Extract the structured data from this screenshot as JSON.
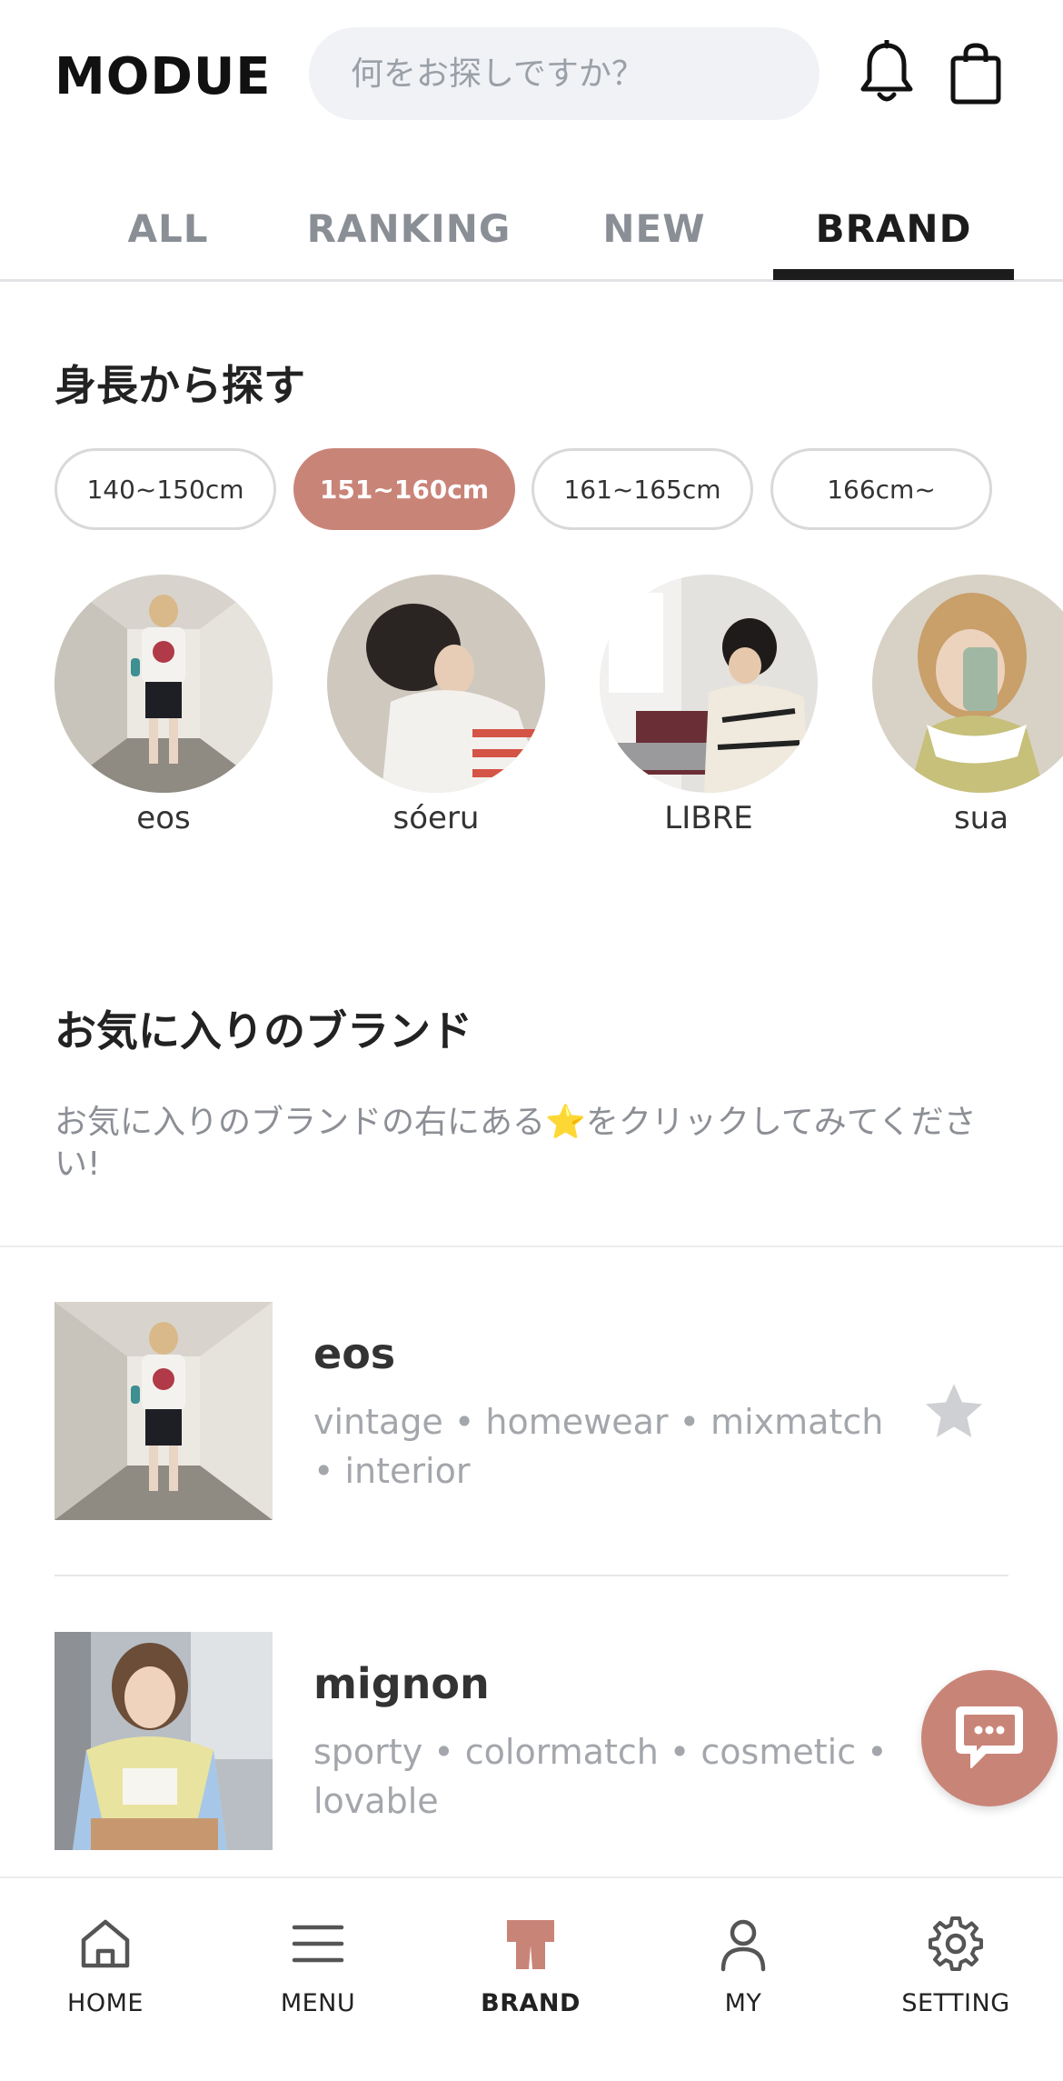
{
  "header": {
    "logo": "MODUE",
    "search_placeholder": "何をお探しですか？",
    "bell_icon": "bell-icon",
    "bag_icon": "shopping-bag-icon"
  },
  "tabs": [
    {
      "label": "ALL",
      "active": false
    },
    {
      "label": "RANKING",
      "active": false
    },
    {
      "label": "NEW",
      "active": false
    },
    {
      "label": "BRAND",
      "active": true
    }
  ],
  "height_section": {
    "title": "身長から探す",
    "ranges": [
      {
        "label": "140~150cm",
        "selected": false
      },
      {
        "label": "151~160cm",
        "selected": true
      },
      {
        "label": "161~165cm",
        "selected": false
      },
      {
        "label": "166cm~",
        "selected": false
      }
    ],
    "brands": [
      {
        "name": "eos"
      },
      {
        "name": "sóeru"
      },
      {
        "name": "LIBRE"
      },
      {
        "name": "sua"
      }
    ]
  },
  "favorites_section": {
    "title": "お気に入りのブランド",
    "description_before": "お気に入りのブランドの右にある",
    "description_emoji": "⭐",
    "description_after": "をクリックしてみてください!",
    "items": [
      {
        "name": "eos",
        "tags": "vintage • homewear • mixmatch • interior",
        "favorited": false
      },
      {
        "name": "mignon",
        "tags": "sporty • colormatch • cosmetic • lovable",
        "favorited": false
      }
    ]
  },
  "chat_button_icon": "chat-bubble-icon",
  "bottom_nav": [
    {
      "label": "HOME",
      "icon": "home-icon",
      "active": false
    },
    {
      "label": "MENU",
      "icon": "menu-icon",
      "active": false
    },
    {
      "label": "BRAND",
      "icon": "brand-shirt-icon",
      "active": true
    },
    {
      "label": "MY",
      "icon": "user-icon",
      "active": false
    },
    {
      "label": "SETTING",
      "icon": "gear-icon",
      "active": false
    }
  ],
  "colors": {
    "accent": "#c98478",
    "active_text": "#1c1c1c",
    "inactive_text": "#8a8f96",
    "search_bg": "#f1f2f6"
  }
}
